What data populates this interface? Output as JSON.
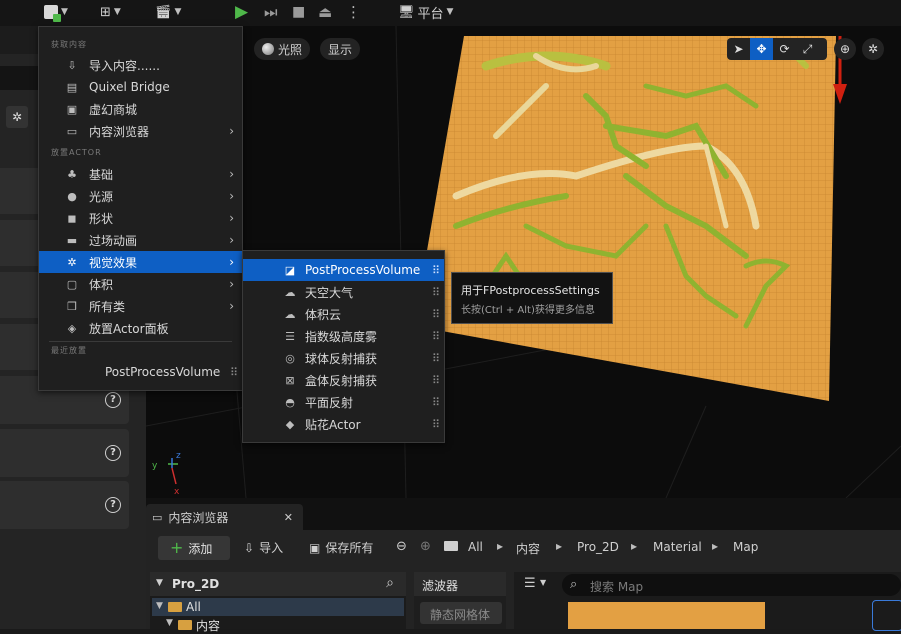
{
  "toolbar": {
    "platform_label": "平台"
  },
  "viewport": {
    "lighting_label": "光照",
    "show_label": "显示"
  },
  "create_menu": {
    "section_get": "获取内容",
    "import": "导入内容......",
    "quixel": "Quixel Bridge",
    "marketplace": "虚幻商城",
    "content_browser": "内容浏览器",
    "section_place": "放置ACTOR",
    "basic": "基础",
    "lights": "光源",
    "shapes": "形状",
    "cinematic": "过场动画",
    "visual_effects": "视觉效果",
    "volumes": "体积",
    "all_classes": "所有类",
    "place_actors_panel": "放置Actor面板",
    "section_recent": "最近放置",
    "recent_item": "PostProcessVolume"
  },
  "submenu": {
    "items": [
      "PostProcessVolume",
      "天空大气",
      "体积云",
      "指数级高度雾",
      "球体反射捕获",
      "盒体反射捕获",
      "平面反射",
      "贴花Actor"
    ]
  },
  "tooltip": {
    "title": "用于FPostprocessSettings",
    "hint": "长按(Ctrl + Alt)获得更多信息"
  },
  "content_browser": {
    "tab_label": "内容浏览器",
    "add_label": "添加",
    "import_label": "导入",
    "save_all_label": "保存所有",
    "breadcrumb": [
      "All",
      "内容",
      "Pro_2D",
      "Material",
      "Map"
    ],
    "tree_title": "Pro_2D",
    "tree_all": "All",
    "tree_content": "内容",
    "filters_label": "滤波器",
    "filter_chip": "静态网格体",
    "search_placeholder": "搜索 Map"
  },
  "colors": {
    "accent": "#0e5fc4",
    "ground": "#e3a043",
    "foliage": "#8fb330",
    "add_green": "#4fb84a"
  }
}
